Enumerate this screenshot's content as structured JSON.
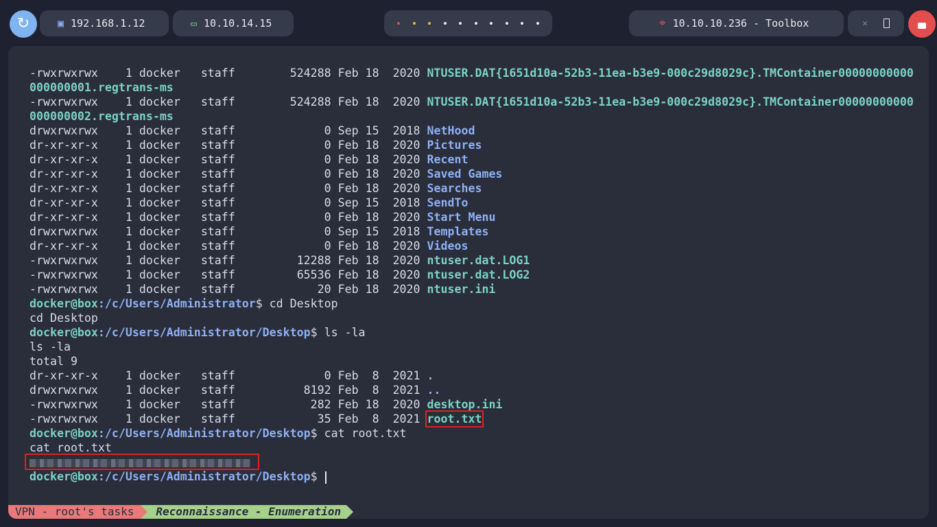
{
  "topbar": {
    "ip_local": "192.168.1.12",
    "ip_vpn": "10.10.14.15",
    "target": "10.10.10.236 - Toolbox",
    "colors": {
      "pill_bg": "#353b4a",
      "lock": "#e44d4d",
      "launcher": "#7fb4f0"
    }
  },
  "terminal": {
    "lines": [
      {
        "perm": "-rwxrwxrwx",
        "links": "1",
        "owner": "docker",
        "group": "staff",
        "size": "524288",
        "date": "Feb 18  2020",
        "name": "NTUSER.DAT{1651d10a-52b3-11ea-b3e9-000c29d8029c}.TMContainer00000000000"
      },
      {
        "cont": "000000001.regtrans-ms"
      },
      {
        "perm": "-rwxrwxrwx",
        "links": "1",
        "owner": "docker",
        "group": "staff",
        "size": "524288",
        "date": "Feb 18  2020",
        "name": "NTUSER.DAT{1651d10a-52b3-11ea-b3e9-000c29d8029c}.TMContainer00000000000"
      },
      {
        "cont": "000000002.regtrans-ms"
      },
      {
        "perm": "drwxrwxrwx",
        "links": "1",
        "owner": "docker",
        "group": "staff",
        "size": "0",
        "date": "Sep 15  2018",
        "name": "NetHood",
        "kind": "dir"
      },
      {
        "perm": "dr-xr-xr-x",
        "links": "1",
        "owner": "docker",
        "group": "staff",
        "size": "0",
        "date": "Feb 18  2020",
        "name": "Pictures",
        "kind": "dir"
      },
      {
        "perm": "dr-xr-xr-x",
        "links": "1",
        "owner": "docker",
        "group": "staff",
        "size": "0",
        "date": "Feb 18  2020",
        "name": "Recent",
        "kind": "dir"
      },
      {
        "perm": "dr-xr-xr-x",
        "links": "1",
        "owner": "docker",
        "group": "staff",
        "size": "0",
        "date": "Feb 18  2020",
        "name": "Saved Games",
        "kind": "dir"
      },
      {
        "perm": "dr-xr-xr-x",
        "links": "1",
        "owner": "docker",
        "group": "staff",
        "size": "0",
        "date": "Feb 18  2020",
        "name": "Searches",
        "kind": "dir"
      },
      {
        "perm": "dr-xr-xr-x",
        "links": "1",
        "owner": "docker",
        "group": "staff",
        "size": "0",
        "date": "Sep 15  2018",
        "name": "SendTo",
        "kind": "dir"
      },
      {
        "perm": "dr-xr-xr-x",
        "links": "1",
        "owner": "docker",
        "group": "staff",
        "size": "0",
        "date": "Feb 18  2020",
        "name": "Start Menu",
        "kind": "dir"
      },
      {
        "perm": "drwxrwxrwx",
        "links": "1",
        "owner": "docker",
        "group": "staff",
        "size": "0",
        "date": "Sep 15  2018",
        "name": "Templates",
        "kind": "dir"
      },
      {
        "perm": "dr-xr-xr-x",
        "links": "1",
        "owner": "docker",
        "group": "staff",
        "size": "0",
        "date": "Feb 18  2020",
        "name": "Videos",
        "kind": "dir"
      },
      {
        "perm": "-rwxrwxrwx",
        "links": "1",
        "owner": "docker",
        "group": "staff",
        "size": "12288",
        "date": "Feb 18  2020",
        "name": "ntuser.dat.LOG1"
      },
      {
        "perm": "-rwxrwxrwx",
        "links": "1",
        "owner": "docker",
        "group": "staff",
        "size": "65536",
        "date": "Feb 18  2020",
        "name": "ntuser.dat.LOG2"
      },
      {
        "perm": "-rwxrwxrwx",
        "links": "1",
        "owner": "docker",
        "group": "staff",
        "size": "20",
        "date": "Feb 18  2020",
        "name": "ntuser.ini"
      },
      {
        "prompt_user": "docker@box",
        "prompt_path": ":/c/Users/Administrator",
        "cmd": "$ cd Desktop"
      },
      {
        "text": "cd Desktop"
      },
      {
        "prompt_user": "docker@box",
        "prompt_path": ":/c/Users/Administrator/Desktop",
        "cmd": "$ ls -la"
      },
      {
        "text": "ls -la"
      },
      {
        "text": "total 9"
      },
      {
        "perm": "dr-xr-xr-x",
        "links": "1",
        "owner": "docker",
        "group": "staff",
        "size": "0",
        "date": "Feb  8  2021",
        "name": ".",
        "kind": "dir"
      },
      {
        "perm": "drwxrwxrwx",
        "links": "1",
        "owner": "docker",
        "group": "staff",
        "size": "8192",
        "date": "Feb  8  2021",
        "name": "..",
        "kind": "dir"
      },
      {
        "perm": "-rwxrwxrwx",
        "links": "1",
        "owner": "docker",
        "group": "staff",
        "size": "282",
        "date": "Feb 18  2020",
        "name": "desktop.ini"
      },
      {
        "perm": "-rwxrwxrwx",
        "links": "1",
        "owner": "docker",
        "group": "staff",
        "size": "35",
        "date": "Feb  8  2021",
        "name": "root.txt",
        "highlight": true
      },
      {
        "prompt_user": "docker@box",
        "prompt_path": ":/c/Users/Administrator/Desktop",
        "cmd": "$ cat root.txt"
      },
      {
        "text": "cat root.txt"
      },
      {
        "redacted": true
      },
      {
        "prompt_user": "docker@box",
        "prompt_path": ":/c/Users/Administrator/Desktop",
        "cmd": "$ ",
        "cursor": true
      }
    ]
  },
  "statusbar": {
    "session": "VPN - root's tasks",
    "window": "Reconnaissance - Enumeration"
  }
}
